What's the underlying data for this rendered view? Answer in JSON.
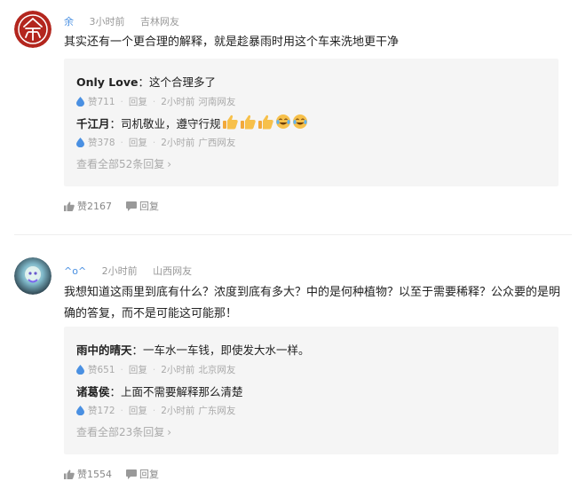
{
  "comments": [
    {
      "username": "余",
      "time": "3小时前",
      "location": "吉林网友",
      "text": "其实还有一个更合理的解释，就是趁暴雨时用这个车来洗地更干净",
      "replies": [
        {
          "name": "Only Love",
          "text": "：这个合理多了",
          "likes": "赞711",
          "reply_label": "回复",
          "time": "2小时前",
          "location": "河南网友"
        },
        {
          "name": "千江月",
          "text": "：司机敬业，遵守行规",
          "likes": "赞378",
          "reply_label": "回复",
          "time": "2小时前",
          "location": "广西网友"
        }
      ],
      "view_all": "查看全部52条回复",
      "likes": "赞2167",
      "reply_label": "回复"
    },
    {
      "username": "^o^",
      "time": "2小时前",
      "location": "山西网友",
      "text": "我想知道这雨里到底有什么？浓度到底有多大？中的是何种植物？以至于需要稀释？公众要的是明确的答复，而不是可能这可能那！",
      "replies": [
        {
          "name": "雨中的晴天",
          "text": "：一车水一车钱，即使发大水一样。",
          "likes": "赞651",
          "reply_label": "回复",
          "time": "2小时前",
          "location": "北京网友"
        },
        {
          "name": "诸葛侯",
          "text": "：上面不需要解释那么清楚",
          "likes": "赞172",
          "reply_label": "回复",
          "time": "2小时前",
          "location": "广东网友"
        }
      ],
      "view_all": "查看全部23条回复",
      "likes": "赞1554",
      "reply_label": "回复"
    }
  ],
  "colors": {
    "username": "#4a90e2",
    "reply_box_bg": "#f5f5f5",
    "meta_gray": "#999999",
    "avatar1_red": "#b3261e"
  }
}
